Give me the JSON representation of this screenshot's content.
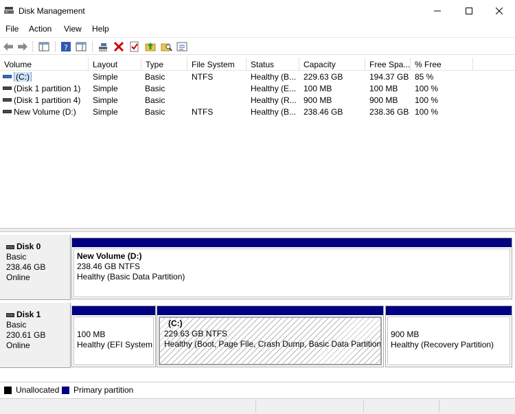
{
  "window": {
    "title": "Disk Management"
  },
  "menu": [
    "File",
    "Action",
    "View",
    "Help"
  ],
  "toolbar": [
    "back-arrow-icon",
    "forward-arrow-icon",
    "console-tree-icon",
    "help-icon",
    "properties-pane-icon",
    "connect-disk-icon",
    "delete-icon",
    "checkmark-icon",
    "folder-up-icon",
    "search-folder-icon",
    "properties-icon"
  ],
  "table": {
    "columns": [
      "Volume",
      "Layout",
      "Type",
      "File System",
      "Status",
      "Capacity",
      "Free Spa...",
      "% Free"
    ],
    "rows": [
      {
        "volume": "(C:)",
        "layout": "Simple",
        "type": "Basic",
        "fs": "NTFS",
        "status": "Healthy (B...",
        "capacity": "229.63 GB",
        "free": "194.37 GB",
        "pct": "85 %"
      },
      {
        "volume": "(Disk 1 partition 1)",
        "layout": "Simple",
        "type": "Basic",
        "fs": "",
        "status": "Healthy (E...",
        "capacity": "100 MB",
        "free": "100 MB",
        "pct": "100 %"
      },
      {
        "volume": "(Disk 1 partition 4)",
        "layout": "Simple",
        "type": "Basic",
        "fs": "",
        "status": "Healthy (R...",
        "capacity": "900 MB",
        "free": "900 MB",
        "pct": "100 %"
      },
      {
        "volume": "New Volume (D:)",
        "layout": "Simple",
        "type": "Basic",
        "fs": "NTFS",
        "status": "Healthy (B...",
        "capacity": "238.46 GB",
        "free": "238.36 GB",
        "pct": "100 %"
      }
    ]
  },
  "disks": [
    {
      "name": "Disk 0",
      "type": "Basic",
      "size": "238.46 GB",
      "state": "Online",
      "partitions": [
        {
          "name": "New Volume  (D:)",
          "size": "238.46 GB NTFS",
          "status": "Healthy (Basic Data Partition)"
        }
      ]
    },
    {
      "name": "Disk 1",
      "type": "Basic",
      "size": "230.61 GB",
      "state": "Online",
      "partitions": [
        {
          "name": "",
          "size": "100 MB",
          "status": "Healthy (EFI System"
        },
        {
          "name": "(C:)",
          "size": "229.63 GB NTFS",
          "status": "Healthy (Boot, Page File, Crash Dump, Basic Data Partition)"
        },
        {
          "name": "",
          "size": "900 MB",
          "status": "Healthy (Recovery Partition)"
        }
      ]
    }
  ],
  "legend": [
    {
      "label": "Unallocated",
      "color": "#000000"
    },
    {
      "label": "Primary partition",
      "color": "#000080"
    }
  ],
  "colors": {
    "partition_bar": "#000080",
    "selection": "#cce4f7"
  }
}
